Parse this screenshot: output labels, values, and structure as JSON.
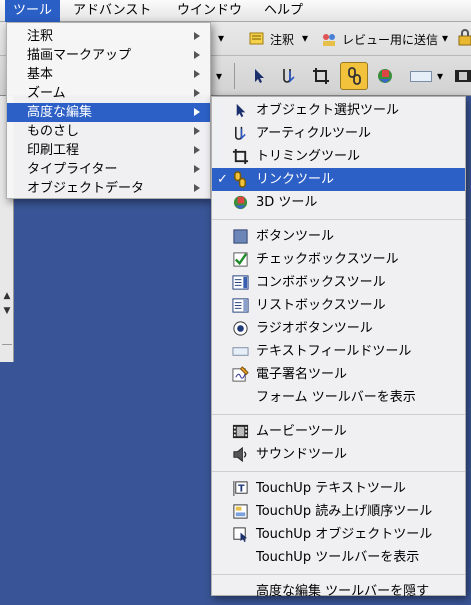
{
  "menubar": {
    "items": [
      "ツール",
      "アドバンスト",
      "ウインドウ",
      "ヘルプ"
    ]
  },
  "toolbar": {
    "annotation_label": "注釈",
    "review_label": "レビュー用に送信"
  },
  "main_menu": {
    "items": [
      {
        "label": "注釈"
      },
      {
        "label": "描画マークアップ"
      },
      {
        "label": "基本"
      },
      {
        "label": "ズーム"
      },
      {
        "label": "高度な編集"
      },
      {
        "label": "ものさし"
      },
      {
        "label": "印刷工程"
      },
      {
        "label": "タイプライター"
      },
      {
        "label": "オブジェクトデータ"
      }
    ]
  },
  "submenu": {
    "group1": [
      {
        "label": "オブジェクト選択ツール",
        "icon": "arrow-select-icon"
      },
      {
        "label": "アーティクルツール",
        "icon": "article-icon"
      },
      {
        "label": "トリミングツール",
        "icon": "crop-icon"
      },
      {
        "label": "リンクツール",
        "icon": "link-icon"
      },
      {
        "label": "3D ツール",
        "icon": "3d-icon"
      }
    ],
    "checked_item": "リンクツール",
    "group2": [
      {
        "label": "ボタンツール",
        "icon": "button-tool-icon"
      },
      {
        "label": "チェックボックスツール",
        "icon": "checkbox-tool-icon"
      },
      {
        "label": "コンボボックスツール",
        "icon": "combobox-tool-icon"
      },
      {
        "label": "リストボックスツール",
        "icon": "listbox-tool-icon"
      },
      {
        "label": "ラジオボタンツール",
        "icon": "radio-tool-icon"
      },
      {
        "label": "テキストフィールドツール",
        "icon": "textfield-tool-icon"
      },
      {
        "label": "電子署名ツール",
        "icon": "signature-tool-icon"
      },
      {
        "label": "フォーム ツールバーを表示",
        "icon": ""
      }
    ],
    "group3": [
      {
        "label": "ムービーツール",
        "icon": "movie-icon"
      },
      {
        "label": "サウンドツール",
        "icon": "sound-icon"
      }
    ],
    "group4": [
      {
        "label": "TouchUp テキストツール",
        "icon": "touchup-text-icon"
      },
      {
        "label": "TouchUp 読み上げ順序ツール",
        "icon": "touchup-order-icon"
      },
      {
        "label": "TouchUp オブジェクトツール",
        "icon": "touchup-object-icon"
      },
      {
        "label": "TouchUp  ツールバーを表示",
        "icon": ""
      }
    ],
    "group5": [
      {
        "label": "高度な編集 ツールバーを隠す",
        "icon": ""
      }
    ]
  },
  "colors": {
    "highlight": "#2d60c7",
    "desktop": "#3a5597"
  }
}
